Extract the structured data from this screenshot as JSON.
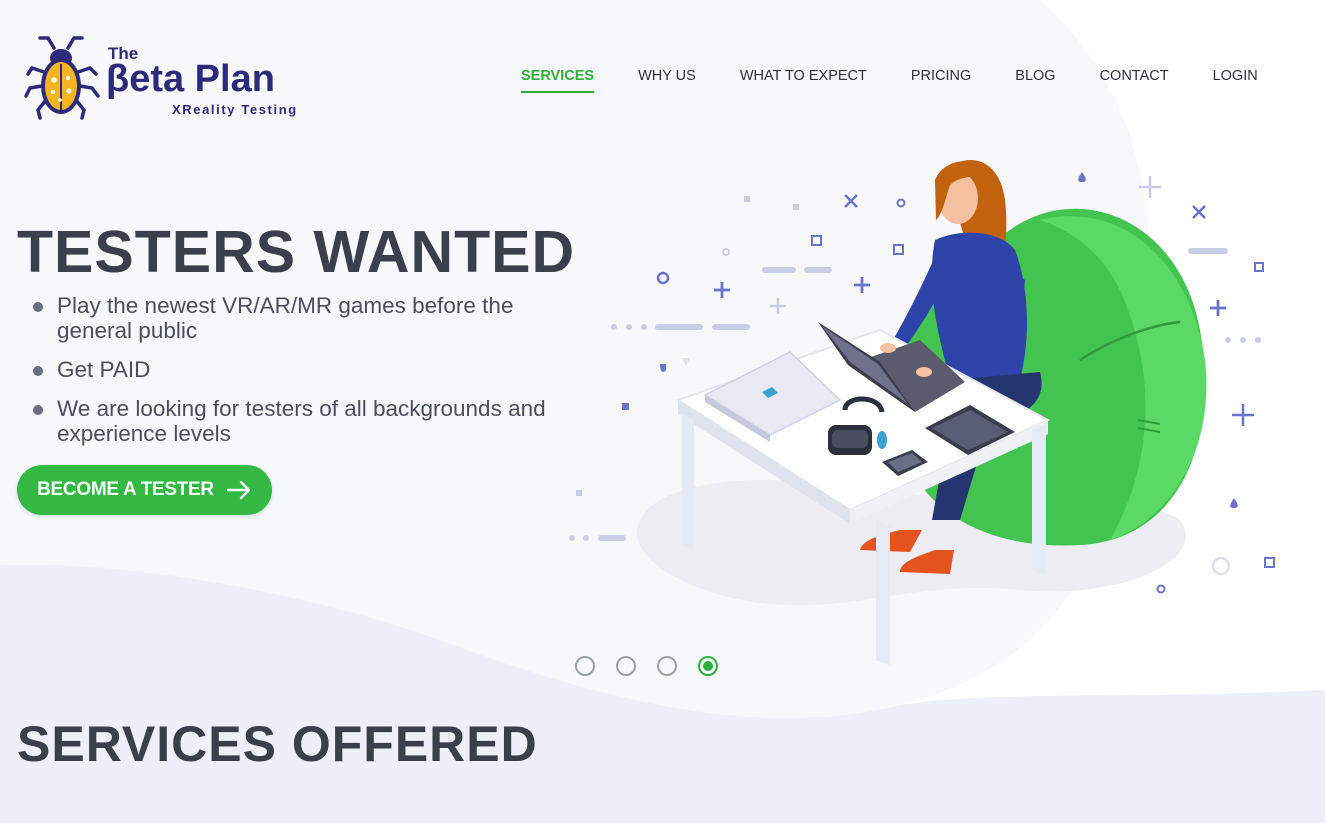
{
  "brand": {
    "the": "The",
    "name": "βeta Plan",
    "tagline": "XReality Testing",
    "colors": {
      "primary": "#2e2a7a",
      "bug": "#f4b51f"
    }
  },
  "nav": {
    "items": [
      {
        "label": "SERVICES",
        "active": true
      },
      {
        "label": "WHY US",
        "active": false
      },
      {
        "label": "WHAT TO EXPECT",
        "active": false
      },
      {
        "label": "PRICING",
        "active": false
      },
      {
        "label": "BLOG",
        "active": false
      },
      {
        "label": "CONTACT",
        "active": false
      },
      {
        "label": "LOGIN",
        "active": false
      }
    ],
    "active_color": "#2fae3c"
  },
  "hero": {
    "title": "TESTERS WANTED",
    "bullets": [
      "Play the newest VR/AR/MR games before the general public",
      "Get PAID",
      "We are looking for testers of all backgrounds and experience levels"
    ],
    "cta_label": "BECOME A TESTER",
    "cta_icon": "arrow-right-icon",
    "cta_color": "#32b843"
  },
  "carousel": {
    "slide_count": 4,
    "active_index": 3
  },
  "services": {
    "title": "SERVICES OFFERED"
  }
}
